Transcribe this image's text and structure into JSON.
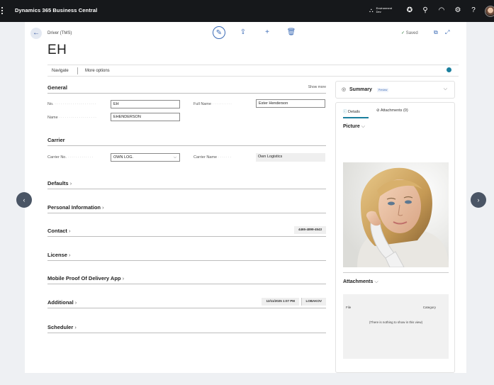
{
  "topbar": {
    "app_name": "Dynamics 365 Business Central",
    "env_label": "Environment",
    "env_value": "Dev"
  },
  "header": {
    "breadcrumb": "Driver (TMS)",
    "title": "EH",
    "saved": "Saved"
  },
  "menu": {
    "navigate": "Navigate",
    "more_options": "More options"
  },
  "general": {
    "title": "General",
    "show_more": "Show more",
    "no_label": "No.",
    "no_value": "EH",
    "name_label": "Name",
    "name_value": "EHENDERSON",
    "full_name_label": "Full Name",
    "full_name_value": "Ester Henderson"
  },
  "carrier": {
    "title": "Carrier",
    "carrier_no_label": "Carrier No.",
    "carrier_no_value": "OWN LOG.",
    "carrier_name_label": "Carrier Name",
    "carrier_name_value": "Own Logistics"
  },
  "sections": {
    "defaults": "Defaults",
    "personal": "Personal Information",
    "contact": "Contact",
    "contact_summary": "4465-4899-4543",
    "license": "License",
    "mobile": "Mobile Proof Of Delivery App",
    "additional": "Additional",
    "additional_date": "12/11/2025 1:07 PM",
    "additional_user": "LOBAKOV",
    "scheduler": "Scheduler"
  },
  "factbox": {
    "summary": "Summary",
    "preview": "Preview",
    "tab_details": "Details",
    "tab_attachments": "Attachments (0)",
    "picture": "Picture",
    "attachments": "Attachments",
    "col_file": "File",
    "col_category": "Category",
    "empty": "(There is nothing to show in this view)"
  }
}
